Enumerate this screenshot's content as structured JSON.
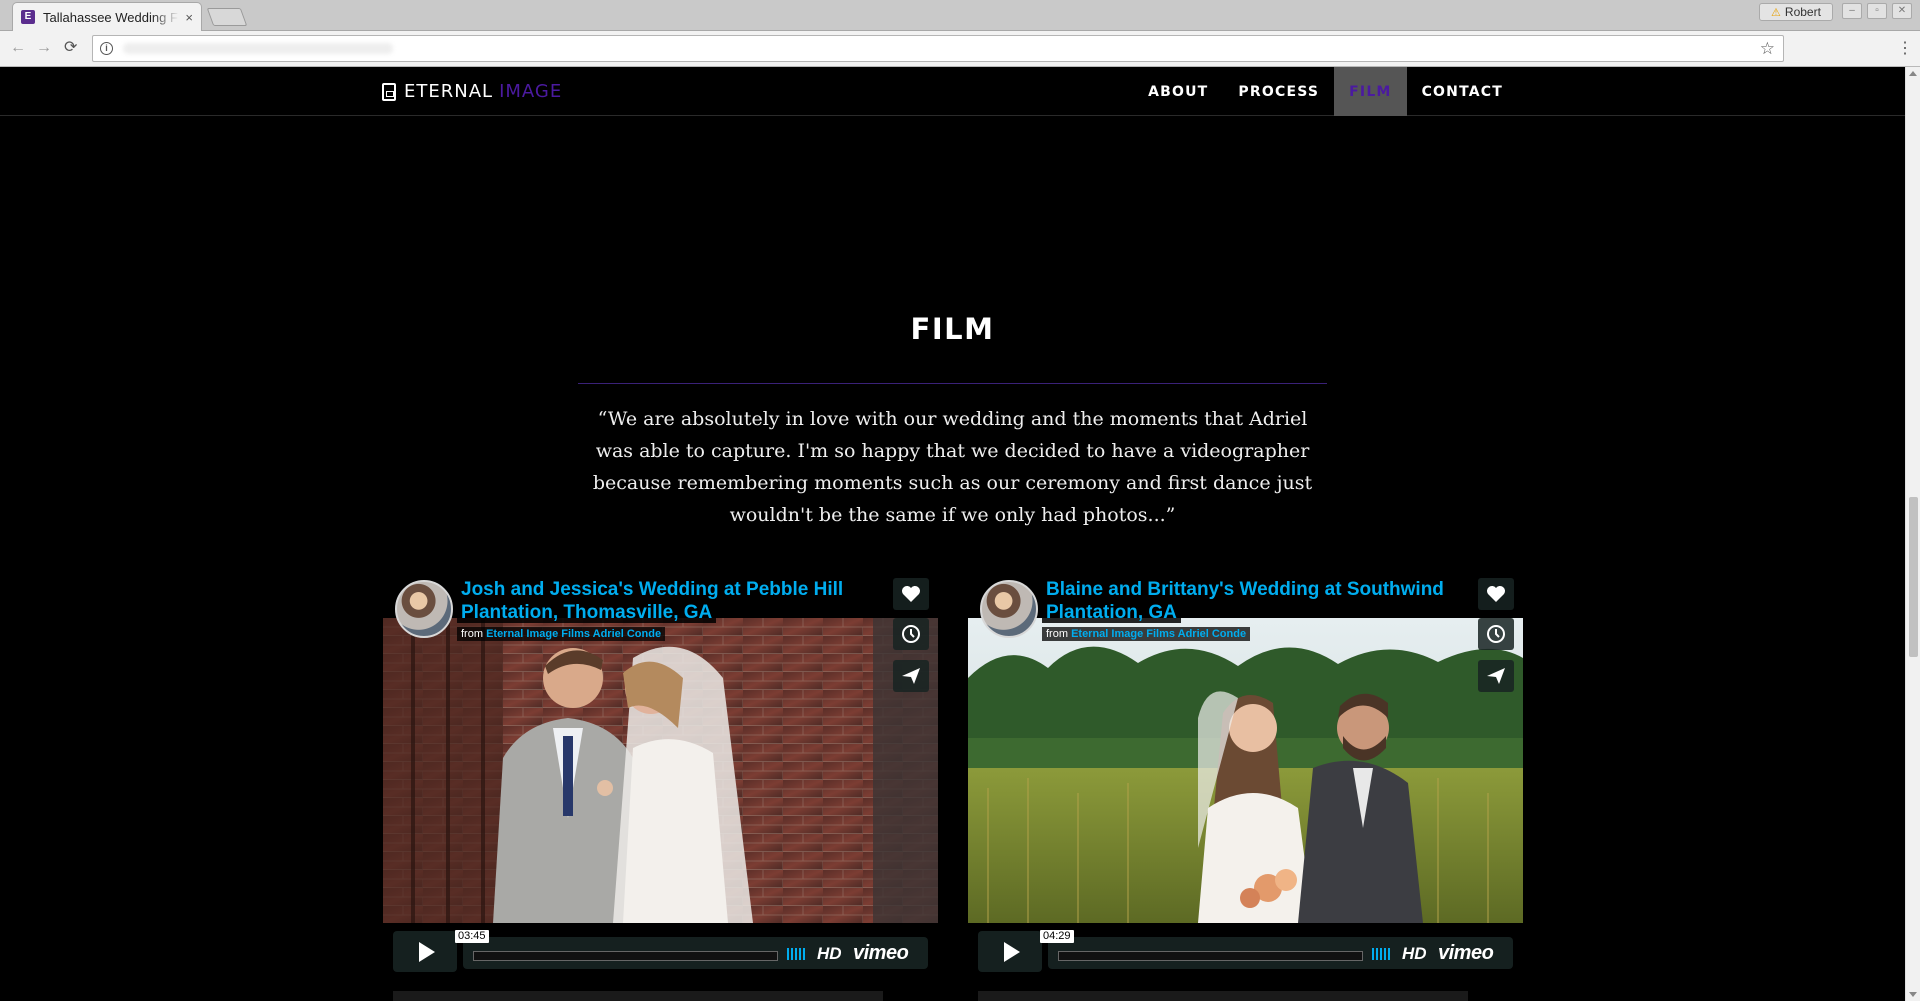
{
  "browser": {
    "tab_title": "Tallahassee Wedding Films",
    "tab_favicon": "E",
    "tab_close": "×",
    "profile_name": "Robert",
    "warning_icon": "⚠",
    "back": "←",
    "forward": "→",
    "reload": "⟳",
    "info": "i",
    "star": "☆",
    "menu": "⋮",
    "win_min": "–",
    "win_max": "▫",
    "win_close": "✕"
  },
  "nav": {
    "brand_word1": "ETERNAL",
    "brand_word2": "IMAGE",
    "links": [
      "ABOUT",
      "PROCESS",
      "FILM",
      "CONTACT"
    ],
    "active": "FILM",
    "active_color": "#4b1aa0"
  },
  "section": {
    "title": "FILM",
    "quote": "“We are absolutely in love with our wedding and the moments that Adriel was able to capture. I'm so happy that we decided to have a videographer because remembering moments such as our ceremony and first dance just wouldn't be the same if we only had photos...”"
  },
  "videos": [
    {
      "title": "Josh and Jessica's Wedding at Pebble Hill Plantation, Thomasville, GA",
      "from_label": "from",
      "author": "Eternal Image Films Adriel Conde",
      "duration": "03:45",
      "hd_label": "HD",
      "vimeo_label": "vimeo"
    },
    {
      "title": "Blaine and Brittany's Wedding at Southwind Plantation, GA",
      "from_label": "from",
      "author": "Eternal Image Films Adriel Conde",
      "duration": "04:29",
      "hd_label": "HD",
      "vimeo_label": "vimeo"
    }
  ],
  "colors": {
    "vimeo_blue": "#00adef",
    "brand_purple": "#4b1aa0",
    "divider": "#3a2178"
  }
}
